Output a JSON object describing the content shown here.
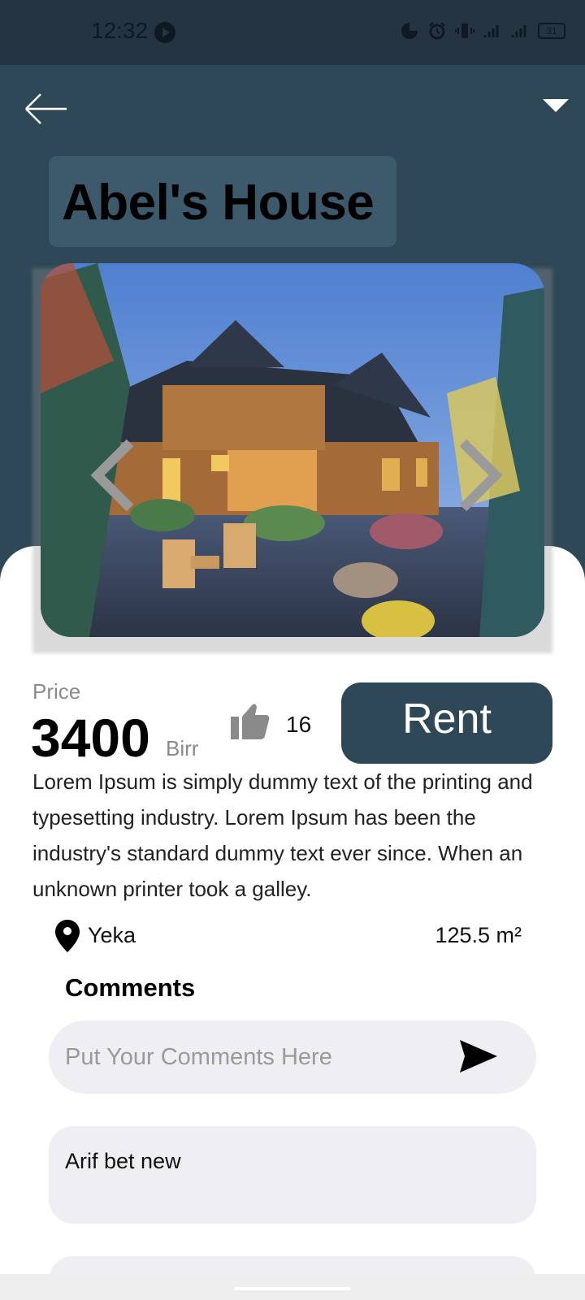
{
  "status_bar": {
    "time": "12:32",
    "battery": "31",
    "icons": [
      "play-icon",
      "data-saver-icon",
      "alarm-icon",
      "vibrate-icon",
      "signal-icon",
      "signal-icon",
      "battery-icon"
    ]
  },
  "header": {
    "back_icon": "arrow-left-icon",
    "menu_icon": "triangle-down-icon",
    "title": "Abel's House"
  },
  "gallery": {
    "prev_icon": "chevron-left-icon",
    "next_icon": "chevron-right-icon"
  },
  "details": {
    "price_label": "Price",
    "price_value": "3400",
    "price_unit": "Birr",
    "likes": "16",
    "like_icon": "thumbs-up-icon",
    "rent_label": "Rent",
    "description": "Lorem Ipsum is simply dummy text of the printing and typesetting industry. Lorem Ipsum has been the industry's standard dummy text ever since. When an unknown printer took a galley.",
    "location": "Yeka",
    "area": "125.5 m²"
  },
  "comments": {
    "heading": "Comments",
    "placeholder": "Put Your Comments Here",
    "send_icon": "send-icon",
    "items": [
      "Arif bet new"
    ]
  },
  "colors": {
    "header": "#2f4858",
    "title_box": "#3c5a6c",
    "status_bar": "#243442",
    "rent_button": "#2f4858",
    "comment_bg": "#efeff3"
  }
}
